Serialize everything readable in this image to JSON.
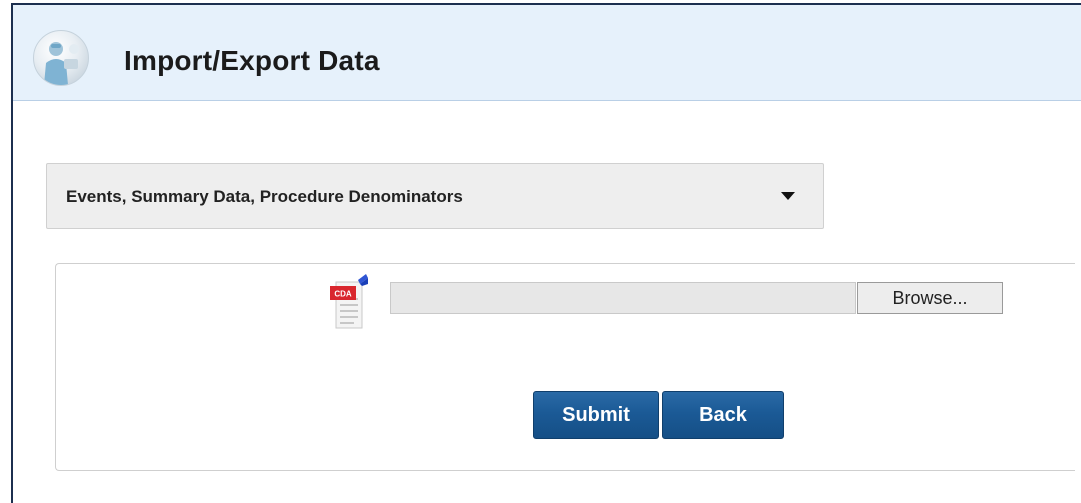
{
  "header": {
    "title": "Import/Export Data",
    "icon": "surgeon-icon"
  },
  "import_type_select": {
    "selected": "Events, Summary Data, Procedure Denominators"
  },
  "file_upload": {
    "icon": "cda-file-icon",
    "icon_text": "CDA",
    "value": "",
    "browse_label": "Browse..."
  },
  "actions": {
    "submit_label": "Submit",
    "back_label": "Back"
  },
  "colors": {
    "header_bg": "#e6f1fb",
    "button_blue": "#1b5a96",
    "frame_border": "#1c2f4f",
    "cda_red": "#d9272e"
  }
}
